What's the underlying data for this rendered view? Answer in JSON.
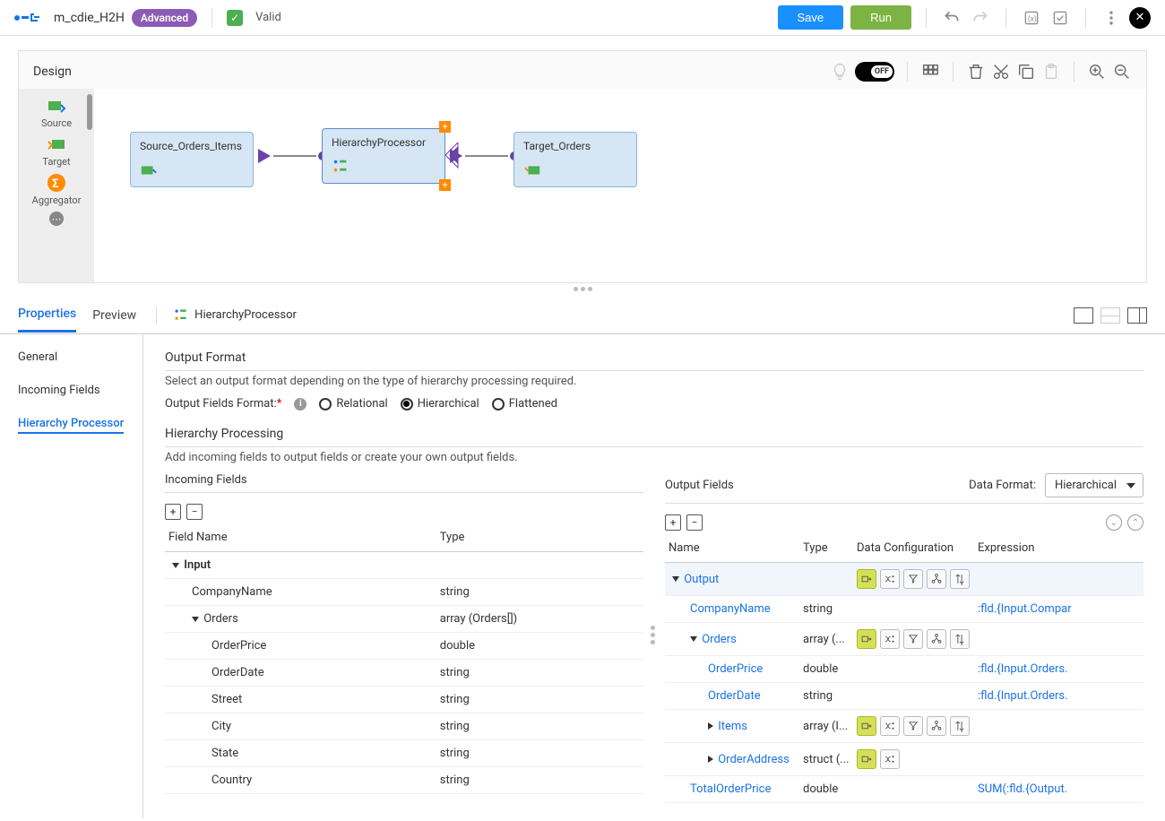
{
  "header": {
    "mapping_name": "m_cdie_H2H",
    "badge": "Advanced",
    "valid_label": "Valid",
    "save": "Save",
    "run": "Run"
  },
  "design": {
    "title": "Design",
    "toggle": "OFF",
    "palette": [
      {
        "label": "Source"
      },
      {
        "label": "Target"
      },
      {
        "label": "Aggregator"
      }
    ],
    "nodes": {
      "source": "Source_Orders_Items",
      "processor": "HierarchyProcessor",
      "target": "Target_Orders"
    }
  },
  "tabs": {
    "properties": "Properties",
    "preview": "Preview",
    "trans": "HierarchyProcessor"
  },
  "sidebar": {
    "general": "General",
    "incoming": "Incoming Fields",
    "hierarchy": "Hierarchy Processor"
  },
  "output_format": {
    "title": "Output Format",
    "desc": "Select an output format depending on the type of hierarchy processing required.",
    "label": "Output Fields Format:",
    "opt_relational": "Relational",
    "opt_hierarchical": "Hierarchical",
    "opt_flattened": "Flattened"
  },
  "hierarchy_proc": {
    "title": "Hierarchy Processing",
    "desc": "Add incoming fields to output fields or create your own output fields."
  },
  "incoming": {
    "title": "Incoming Fields",
    "col_name": "Field Name",
    "col_type": "Type",
    "rows": [
      {
        "name": "Input",
        "indent": 0,
        "toggle": "down"
      },
      {
        "name": "CompanyName",
        "type": "string",
        "indent": 1
      },
      {
        "name": "Orders",
        "type": "array (Orders[])",
        "indent": 1,
        "toggle": "down"
      },
      {
        "name": "OrderPrice",
        "type": "double",
        "indent": 2
      },
      {
        "name": "OrderDate",
        "type": "string",
        "indent": 2
      },
      {
        "name": "Street",
        "type": "string",
        "indent": 2
      },
      {
        "name": "City",
        "type": "string",
        "indent": 2
      },
      {
        "name": "State",
        "type": "string",
        "indent": 2
      },
      {
        "name": "Country",
        "type": "string",
        "indent": 2
      }
    ]
  },
  "output": {
    "title": "Output Fields",
    "data_format_label": "Data Format:",
    "data_format_value": "Hierarchical",
    "col_name": "Name",
    "col_type": "Type",
    "col_config": "Data Configuration",
    "col_expr": "Expression",
    "rows": [
      {
        "name": "Output",
        "indent": 0,
        "toggle": "down",
        "link": true,
        "actions": 5,
        "active": true
      },
      {
        "name": "CompanyName",
        "type": "string",
        "indent": 1,
        "link": true,
        "expr": ":fld.{Input.Compar"
      },
      {
        "name": "Orders",
        "type": "array (...",
        "indent": 1,
        "toggle": "down",
        "link": true,
        "actions": 5,
        "active": true
      },
      {
        "name": "OrderPrice",
        "type": "double",
        "indent": 2,
        "link": true,
        "expr": ":fld.{Input.Orders."
      },
      {
        "name": "OrderDate",
        "type": "string",
        "indent": 2,
        "link": true,
        "expr": ":fld.{Input.Orders."
      },
      {
        "name": "Items",
        "type": "array (I...",
        "indent": 2,
        "toggle": "right",
        "link": true,
        "actions": 5,
        "active": true
      },
      {
        "name": "OrderAddress",
        "type": "struct (...",
        "indent": 2,
        "toggle": "right",
        "link": true,
        "actions": 2,
        "active": true
      },
      {
        "name": "TotalOrderPrice",
        "type": "double",
        "indent": 1,
        "link": true,
        "expr": "SUM(:fld.{Output."
      }
    ]
  }
}
